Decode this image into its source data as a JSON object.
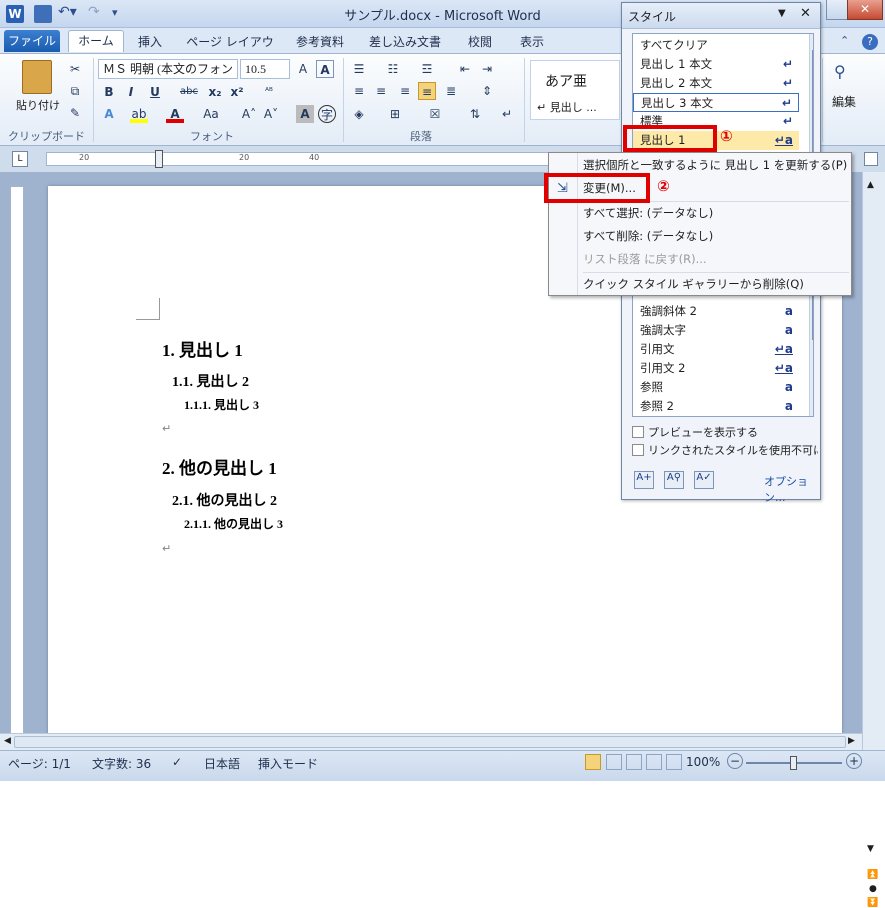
{
  "window": {
    "title": "サンプル.docx - Microsoft Word"
  },
  "tabs": [
    "ホーム",
    "挿入",
    "ページ レイアウト",
    "参考資料",
    "差し込み文書",
    "校閲",
    "表示"
  ],
  "file_tab": "ファイル",
  "clipboard": {
    "paste": "貼り付け",
    "group": "クリップボード"
  },
  "font": {
    "name": "ＭＳ 明朝 (本文のフォン",
    "size": "10.5",
    "group": "フォント"
  },
  "paragraph": {
    "group": "段落"
  },
  "styles_gallery": {
    "sample": "あア亜",
    "label": "↵ 見出し ..."
  },
  "edit": {
    "label": "編集"
  },
  "ruler_marks": [
    "20",
    "20",
    "40"
  ],
  "document": {
    "h1a": "1. 見出し 1",
    "h2a": "1.1. 見出し 2",
    "h3a": "1.1.1. 見出し 3",
    "h1b": "2. 他の見出し 1",
    "h2b": "2.1. 他の見出し 2",
    "h3b": "2.1.1. 他の見出し 3"
  },
  "style_pane": {
    "title": "スタイル",
    "items": [
      {
        "label": "すべてクリア",
        "icon": ""
      },
      {
        "label": "見出し 1 本文",
        "icon": "↵"
      },
      {
        "label": "見出し 2 本文",
        "icon": "↵"
      },
      {
        "label": "見出し 3 本文",
        "icon": "↵"
      },
      {
        "label": "標準",
        "icon": "↵"
      },
      {
        "label": "見出し 1",
        "icon": "↵a"
      }
    ],
    "lower_items": [
      {
        "label": "強調斜体 2",
        "icon": "a"
      },
      {
        "label": "強調太字",
        "icon": "a"
      },
      {
        "label": "引用文",
        "icon": "↵a"
      },
      {
        "label": "引用文 2",
        "icon": "↵a"
      },
      {
        "label": "参照",
        "icon": "a"
      },
      {
        "label": "参照 2",
        "icon": "a"
      }
    ],
    "preview": "プレビューを表示する",
    "disable_linked": "リンクされたスタイルを使用不可にする",
    "options": "オプション..."
  },
  "context_menu": {
    "update": "選択個所と一致するように 見出し 1 を更新する(P)",
    "modify": "変更(M)...",
    "select_all": "すべて選択: (データなし)",
    "clear_all": "すべて削除: (データなし)",
    "revert": "リスト段落 に戻す(R)...",
    "remove_gallery": "クイック スタイル ギャラリーから削除(Q)"
  },
  "callouts": {
    "one": "①",
    "two": "②"
  },
  "status": {
    "page": "ページ: 1/1",
    "words": "文字数: 36",
    "lang": "日本語",
    "mode": "挿入モード",
    "zoom": "100%"
  }
}
